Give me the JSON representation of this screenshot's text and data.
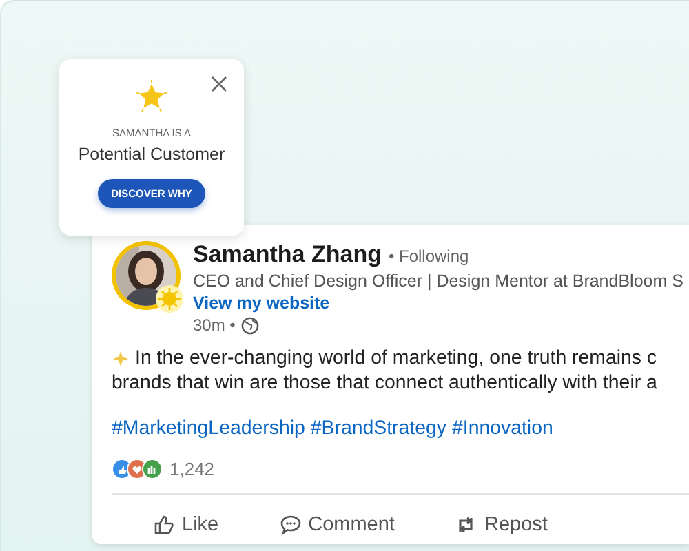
{
  "popup": {
    "eyebrow": "SAMANTHA IS A",
    "title": "Potential Customer",
    "button": "DISCOVER WHY"
  },
  "post": {
    "author": "Samantha Zhang",
    "relation": "• Following",
    "headline": "CEO and Chief Design Officer | Design Mentor at BrandBloom S",
    "website": "View my website",
    "time": "30m •",
    "body_lines": [
      "In the ever-changing world of marketing, one truth remains c",
      "brands that win are those that connect authentically with their a"
    ],
    "hashtags": [
      "#MarketingLeadership",
      "#BrandStrategy",
      "#Innovation"
    ],
    "reaction_count": "1,242",
    "actions": [
      {
        "kind": "like",
        "label": "Like"
      },
      {
        "kind": "comment",
        "label": "Comment"
      },
      {
        "kind": "repost",
        "label": "Repost"
      }
    ]
  }
}
